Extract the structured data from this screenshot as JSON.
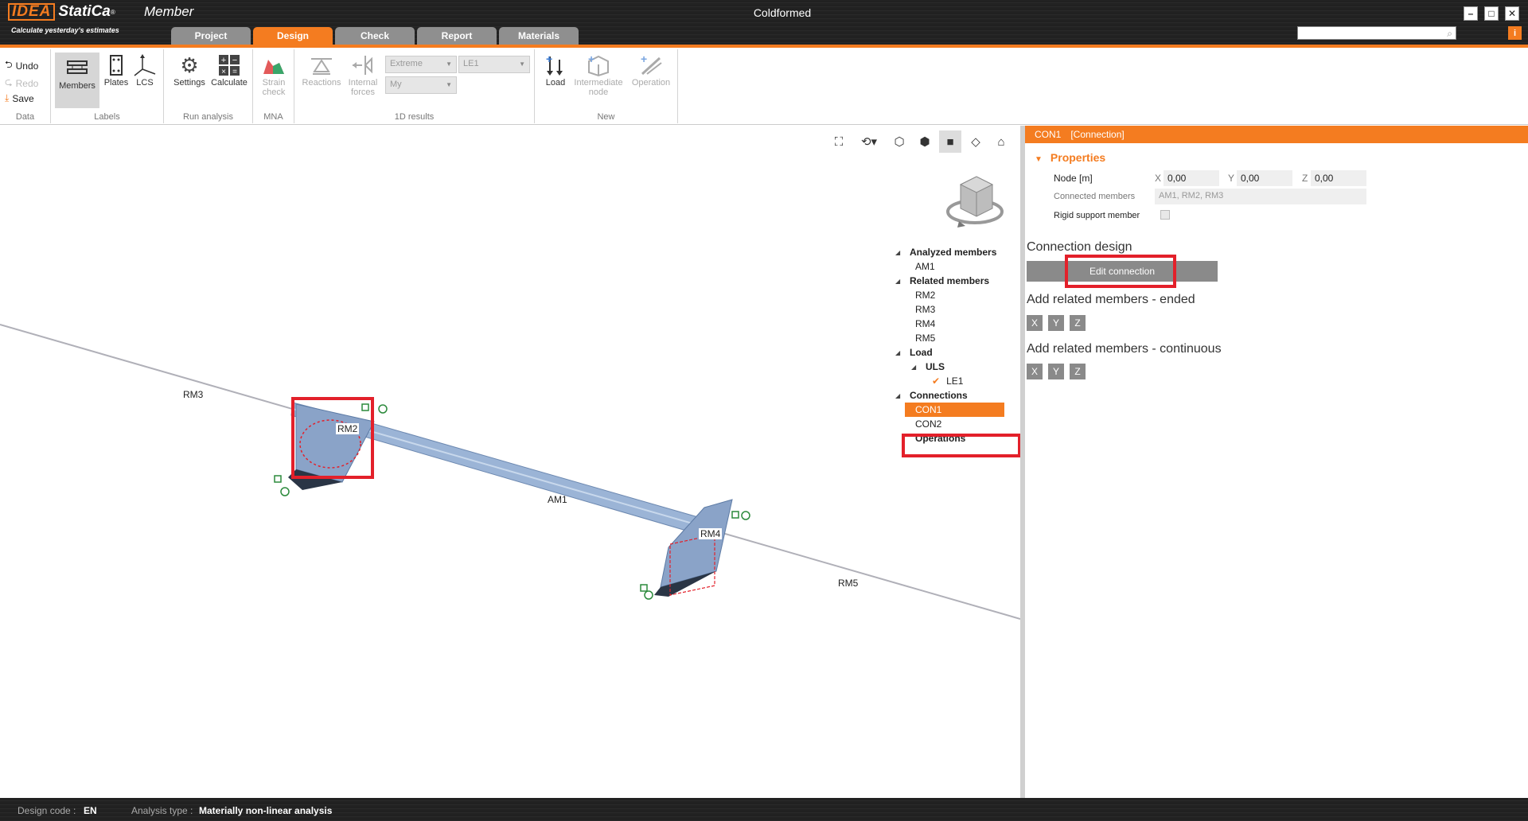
{
  "app": {
    "logo_text": "IDEA",
    "brand": "StatiCa",
    "registered": "®",
    "product": "Member",
    "tagline": "Calculate yesterday's estimates",
    "window_title": "Coldformed",
    "controls": {
      "minimize": "–",
      "maximize": "□",
      "close": "✕"
    },
    "info": "i"
  },
  "tabs": [
    "Project",
    "Design",
    "Check",
    "Report",
    "Materials"
  ],
  "active_tab": "Design",
  "ribbon": {
    "data": {
      "label": "Data",
      "undo": "Undo",
      "redo": "Redo",
      "save": "Save"
    },
    "labels": {
      "label": "Labels",
      "members": "Members",
      "plates": "Plates",
      "lcs": "LCS"
    },
    "run": {
      "label": "Run analysis",
      "settings": "Settings",
      "calculate": "Calculate"
    },
    "mna": {
      "label": "MNA",
      "strain": "Strain",
      "check": "check"
    },
    "results": {
      "label": "1D results",
      "reactions": "Reactions",
      "internal": "Internal",
      "forces": "forces",
      "combo1": "Extreme",
      "combo2": "My",
      "combo3": "LE1"
    },
    "new": {
      "label": "New",
      "load": "Load",
      "intermediate": "Intermediate",
      "node": "node",
      "operation": "Operation"
    }
  },
  "model": {
    "labels": {
      "rm3": "RM3",
      "rm2": "RM2",
      "am1": "AM1",
      "rm4": "RM4",
      "rm5": "RM5"
    }
  },
  "tree": {
    "analyzed_members": "Analyzed members",
    "am1": "AM1",
    "related_members": "Related members",
    "rm2": "RM2",
    "rm3": "RM3",
    "rm4": "RM4",
    "rm5": "RM5",
    "load": "Load",
    "uls": "ULS",
    "le1": "LE1",
    "connections": "Connections",
    "con1": "CON1",
    "con2": "CON2",
    "operations": "Operations"
  },
  "panel": {
    "header_name": "CON1",
    "header_kind": "[Connection]",
    "properties": "Properties",
    "node_label": "Node [m]",
    "x_label": "X",
    "x_value": "0,00",
    "y_label": "Y",
    "y_value": "0,00",
    "z_label": "Z",
    "z_value": "0,00",
    "connected_label": "Connected members",
    "connected_value": "AM1, RM2, RM3",
    "rigid_label": "Rigid support member",
    "connection_design": "Connection design",
    "edit_connection": "Edit connection",
    "add_ended": "Add related members - ended",
    "add_continuous": "Add related members - continuous",
    "axes": [
      "X",
      "Y",
      "Z"
    ]
  },
  "status": {
    "design_code_label": "Design code :",
    "design_code": "EN",
    "analysis_type_label": "Analysis type :",
    "analysis_type": "Materially non-linear analysis"
  },
  "colors": {
    "accent": "#f47c20",
    "highlight": "#e3202a",
    "beam": "#8fa8c8"
  }
}
